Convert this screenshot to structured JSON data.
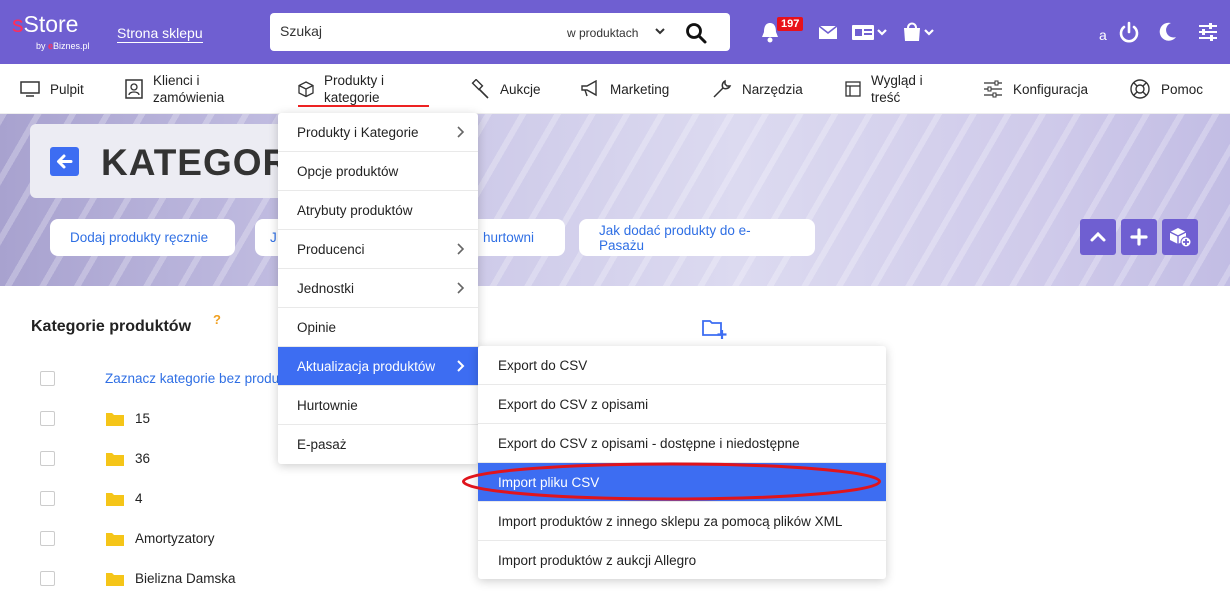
{
  "topbar": {
    "logo_s": "s",
    "logo_rest": "Store",
    "logo_by": "by ",
    "logo_brand": "e",
    "logo_brand_rest": "Biznes.pl",
    "shop_link": "Strona sklepu",
    "search_placeholder": "Szukaj",
    "search_scope": "w produktach",
    "notifications_count": "197",
    "user_initial": "a"
  },
  "nav": {
    "items": [
      {
        "label": "Pulpit"
      },
      {
        "label": "Klienci i",
        "label2": "zamówienia"
      },
      {
        "label": "Produkty i",
        "label2": "kategorie"
      },
      {
        "label": "Aukcje"
      },
      {
        "label": "Marketing"
      },
      {
        "label": "Narzędzia"
      },
      {
        "label": "Wygląd i",
        "label2": "treść"
      },
      {
        "label": "Konfiguracja"
      },
      {
        "label": "Pomoc"
      }
    ]
  },
  "hero": {
    "title": "KATEGOR",
    "pills": [
      "Dodaj produkty ręcznie",
      "J",
      "hurtowni",
      "Jak dodać produkty do e-Pasażu"
    ]
  },
  "content": {
    "section_title": "Kategorie produktów",
    "help_mark": "?",
    "select_link": "Zaznacz kategorie bez produ",
    "categories": [
      "15",
      "36",
      "4",
      "Amortyzatory",
      "Bielizna Damska"
    ]
  },
  "dropdown": {
    "items": [
      "Produkty i Kategorie",
      "Opcje produktów",
      "Atrybuty produktów",
      "Producenci",
      "Jednostki",
      "Opinie",
      "Aktualizacja produktów",
      "Hurtownie",
      "E-pasaż"
    ]
  },
  "submenu": {
    "items": [
      "Export do CSV",
      "Export do CSV z opisami",
      "Export do CSV z opisami - dostępne i niedostępne",
      "Import pliku CSV",
      "Import produktów z innego sklepu za pomocą plików XML",
      "Import produktów z aukcji Allegro"
    ]
  },
  "colors": {
    "topbar": "#6f5fd1",
    "accent": "#3d6df2",
    "link": "#2f6fe4",
    "badge": "#e8111b",
    "highlight_ring": "#e0141c",
    "folder": "#f5c518"
  }
}
